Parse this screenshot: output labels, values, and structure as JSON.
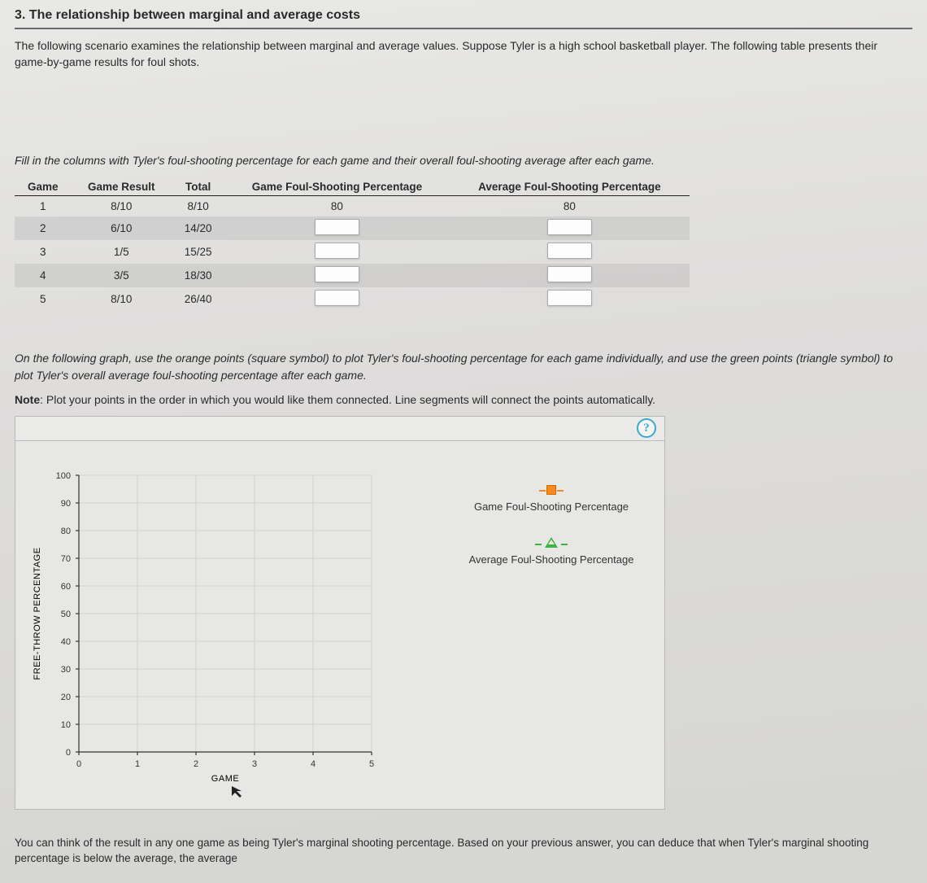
{
  "title": "3. The relationship between marginal and average costs",
  "intro": "The following scenario examines the relationship between marginal and average values. Suppose Tyler is a high school basketball player. The following table presents their game-by-game results for foul shots.",
  "instruction": "Fill in the columns with Tyler's foul-shooting percentage for each game and their overall foul-shooting average after each game.",
  "table": {
    "headers": {
      "game": "Game",
      "result": "Game Result",
      "total": "Total",
      "game_pct": "Game Foul-Shooting Percentage",
      "avg_pct": "Average Foul-Shooting Percentage"
    },
    "rows": [
      {
        "game": "1",
        "result": "8/10",
        "total": "8/10",
        "game_pct": "80",
        "avg_pct": "80",
        "filled": true
      },
      {
        "game": "2",
        "result": "6/10",
        "total": "14/20",
        "game_pct": "",
        "avg_pct": "",
        "filled": false
      },
      {
        "game": "3",
        "result": "1/5",
        "total": "15/25",
        "game_pct": "",
        "avg_pct": "",
        "filled": false
      },
      {
        "game": "4",
        "result": "3/5",
        "total": "18/30",
        "game_pct": "",
        "avg_pct": "",
        "filled": false
      },
      {
        "game": "5",
        "result": "8/10",
        "total": "26/40",
        "game_pct": "",
        "avg_pct": "",
        "filled": false
      }
    ]
  },
  "graph_intro": "On the following graph, use the orange points (square symbol) to plot Tyler's foul-shooting percentage for each game individually, and use the green points (triangle symbol) to plot Tyler's overall average foul-shooting percentage after each game.",
  "graph_note_label": "Note",
  "graph_note": ": Plot your points in the order in which you would like them connected. Line segments will connect the points automatically.",
  "help_symbol": "?",
  "legend": {
    "series1": "Game Foul-Shooting Percentage",
    "series2": "Average Foul-Shooting Percentage"
  },
  "chart_data": {
    "type": "scatter",
    "title": "",
    "xlabel": "GAME",
    "ylabel": "FREE-THROW PERCENTAGE",
    "xlim": [
      0,
      5
    ],
    "ylim": [
      0,
      100
    ],
    "xticks": [
      0,
      1,
      2,
      3,
      4,
      5
    ],
    "yticks": [
      0,
      10,
      20,
      30,
      40,
      50,
      60,
      70,
      80,
      90,
      100
    ],
    "series": [
      {
        "name": "Game Foul-Shooting Percentage",
        "symbol": "square-orange",
        "values": []
      },
      {
        "name": "Average Foul-Shooting Percentage",
        "symbol": "triangle-green",
        "values": []
      }
    ]
  },
  "footer": "You can think of the result in any one game as being Tyler's marginal shooting percentage. Based on your previous answer, you can deduce that when Tyler's marginal shooting percentage is below the average, the average"
}
